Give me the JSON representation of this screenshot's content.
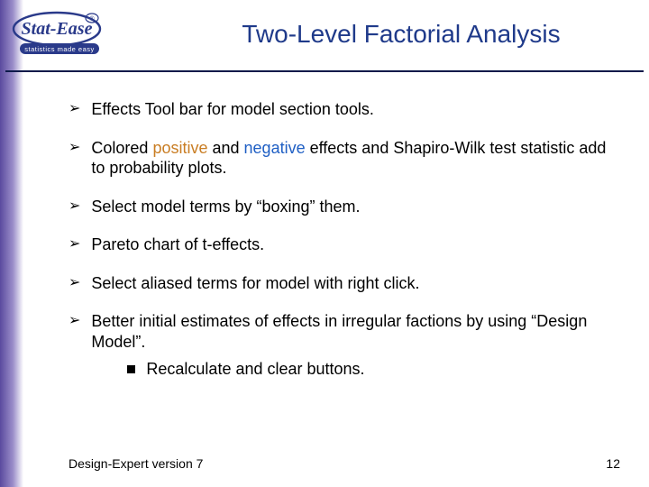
{
  "title": "Two-Level Factorial Analysis",
  "bullets": {
    "b1": "Effects Tool bar for model section tools.",
    "b2a": "Colored ",
    "b2pos": "positive",
    "b2b": " and ",
    "b2neg": "negative",
    "b2c": " effects and Shapiro-Wilk test statistic add to probability plots.",
    "b3": "Select model terms by “boxing” them.",
    "b4": "Pareto chart of t-effects.",
    "b5": "Select aliased terms for model with right click.",
    "b6": "Better initial estimates of effects in irregular factions by using “Design Model”.",
    "b6s1": "Recalculate and clear buttons."
  },
  "footer": {
    "left": "Design-Expert version 7",
    "right": "12"
  },
  "marker": "➢"
}
